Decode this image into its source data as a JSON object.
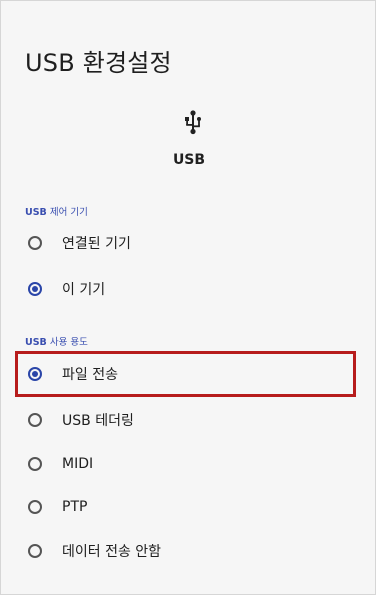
{
  "header": {
    "title": "USB 환경설정"
  },
  "usb_indicator": {
    "icon": "usb-icon",
    "label": "USB"
  },
  "controlling_device": {
    "header_strong": "USB",
    "header_rest": " 제어 기기",
    "options": [
      {
        "label": "연결된 기기",
        "selected": false
      },
      {
        "label": "이 기기",
        "selected": true
      }
    ]
  },
  "usb_purpose": {
    "header_strong": "USB",
    "header_rest": " 사용 용도",
    "options": [
      {
        "label": "파일 전송",
        "selected": true
      },
      {
        "label": "USB 테더링",
        "selected": false
      },
      {
        "label": "MIDI",
        "selected": false
      },
      {
        "label": "PTP",
        "selected": false
      },
      {
        "label": "데이터 전송 안함",
        "selected": false
      }
    ]
  },
  "colors": {
    "accent": "#2a45a8",
    "section_header": "#3a4fb0",
    "highlight": "#b71c1c",
    "background": "#f6f6f6"
  }
}
